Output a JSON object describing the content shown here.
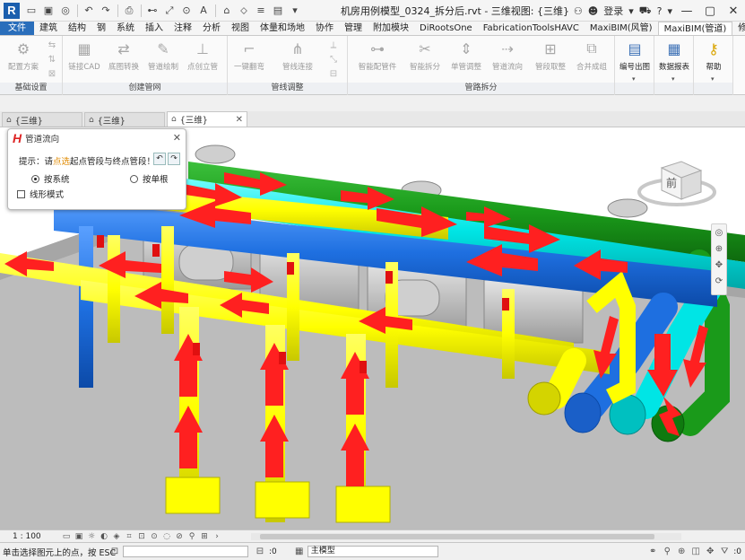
{
  "titlebar": {
    "document_title": "机房用例模型_0324_拆分后.rvt - 三维视图: {三维}",
    "login_label": "登录"
  },
  "ribbon_tabs": [
    "文件",
    "建筑",
    "结构",
    "钢",
    "系统",
    "插入",
    "注释",
    "分析",
    "视图",
    "体量和场地",
    "协作",
    "管理",
    "附加模块",
    "DiRootsOne",
    "FabricationToolsHAVC",
    "MaxiBIM(风管)",
    "MaxiBIM(管道)",
    "修改"
  ],
  "active_tab_index": 16,
  "ribbon": {
    "panels": [
      {
        "title": "基础设置",
        "buttons": [
          "配置方案"
        ]
      },
      {
        "title": "创建管网",
        "buttons": [
          "链接CAD",
          "底图转换",
          "管道绘制",
          "点创立管"
        ]
      },
      {
        "title": "管线调整",
        "buttons": [
          "一键翻弯",
          "管线连接"
        ]
      },
      {
        "title": "管路拆分",
        "buttons": [
          "智能配管件",
          "智能拆分",
          "单管调整",
          "管道流向",
          "管段取整",
          "合并成组"
        ]
      },
      {
        "title": "",
        "buttons": [
          "编号出图"
        ]
      },
      {
        "title": "",
        "buttons": [
          "数据报表"
        ]
      },
      {
        "title": "",
        "buttons": [
          "帮助"
        ]
      }
    ]
  },
  "view_tabs": [
    {
      "label": "{三维}",
      "active": false
    },
    {
      "label": "{三维}",
      "active": false
    },
    {
      "label": "{三维}",
      "active": true
    }
  ],
  "dialog": {
    "title": "管道流向",
    "hint_prefix": "提示：请",
    "hint_highlight": "点选",
    "hint_suffix": "起点管段与终点管段！",
    "radio_system": "按系统",
    "radio_single": "按单根",
    "checkbox_label": "线形模式",
    "selected_radio": "按系统",
    "checkbox_checked": false
  },
  "viewcube": {
    "face_label": "前"
  },
  "view_control": {
    "scale": "1 : 100"
  },
  "statusbar": {
    "prompt": "单击选择图元上的点，按 ESC",
    "field_value_1": ":0",
    "model_label": "主模型",
    "filter_value": ":0"
  },
  "colors": {
    "file_tab": "#2a6ebb",
    "pipe_yellow": "#ffff00",
    "pipe_cyan": "#00e5e5",
    "pipe_blue": "#1e6fe0",
    "pipe_green": "#1a9a1a",
    "flow_arrow": "#ff2020",
    "equipment_gray": "#bdbdbd"
  }
}
